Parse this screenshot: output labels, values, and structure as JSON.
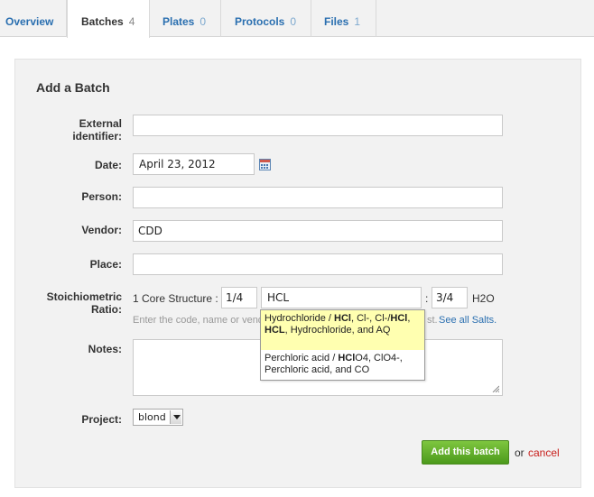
{
  "tabs": [
    {
      "label": "Overview",
      "count": ""
    },
    {
      "label": "Batches",
      "count": "4"
    },
    {
      "label": "Plates",
      "count": "0"
    },
    {
      "label": "Protocols",
      "count": "0"
    },
    {
      "label": "Files",
      "count": "1"
    }
  ],
  "form": {
    "title": "Add a Batch",
    "external_identifier": {
      "label_line1": "External",
      "label_line2": "identifier:",
      "value": ""
    },
    "date": {
      "label": "Date:",
      "value": "April 23, 2012",
      "icon": "calendar-icon"
    },
    "person": {
      "label": "Person:",
      "value": ""
    },
    "vendor": {
      "label": "Vendor:",
      "value": "CDD"
    },
    "place": {
      "label": "Place:",
      "value": ""
    },
    "stoich": {
      "label_line1": "Stoichiometric",
      "label_line2": "Ratio:",
      "core_text": "1 Core Structure :",
      "core_ratio": "1/4",
      "salt_value": "HCL",
      "colon": ":",
      "salt_ratio": "3/4",
      "solvent": "H2O",
      "hint_start": "Enter the code, name or vend",
      "hint_end": "st.",
      "see_all": "See all Salts."
    },
    "autocomplete": {
      "item1": {
        "a": "Hydrochloride / ",
        "b": "HCl",
        "c": ", Cl-, Cl-/",
        "d": "HCl",
        "e": ", ",
        "f": "HCL",
        "g": ", Hydrochloride, and AQ"
      },
      "item2": {
        "a": "Perchloric acid / ",
        "b": "HCl",
        "c": "O4, ClO4-, Perchloric acid, and CO"
      }
    },
    "notes": {
      "label": "Notes:",
      "value": ""
    },
    "project": {
      "label": "Project:",
      "selected": "blond"
    },
    "submit_label": "Add this batch",
    "or_text": "or",
    "cancel_label": "cancel"
  },
  "colors": {
    "accent_link": "#2a6fb0",
    "button_green": "#5fae2c",
    "cancel_red": "#c8201d",
    "highlight": "#ffffb0"
  }
}
